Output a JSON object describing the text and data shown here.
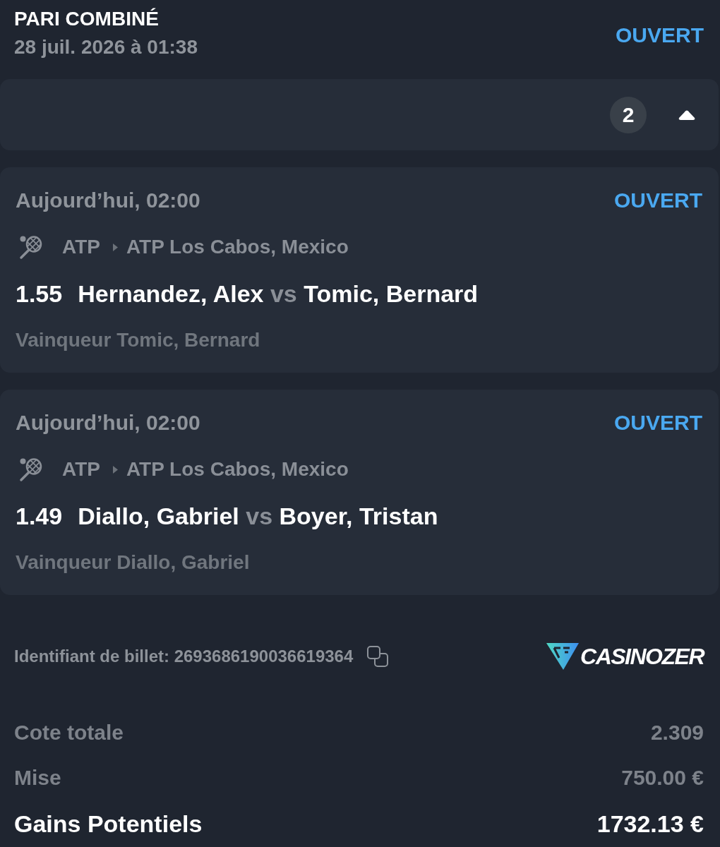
{
  "header": {
    "title": "PARI COMBINÉ",
    "datetime": "28 juil. 2026 à 01:38",
    "status": "OUVERT"
  },
  "selections_panel": {
    "count": "2",
    "expanded": true
  },
  "selections": [
    {
      "time": "Aujourd’hui, 02:00",
      "status": "OUVERT",
      "category": "ATP",
      "tournament": "ATP Los Cabos, Mexico",
      "odds": "1.55",
      "home": "Hernandez, Alex",
      "separator": "vs",
      "away": "Tomic, Bernard",
      "market": "Vainqueur Tomic, Bernard"
    },
    {
      "time": "Aujourd’hui, 02:00",
      "status": "OUVERT",
      "category": "ATP",
      "tournament": "ATP Los Cabos, Mexico",
      "odds": "1.49",
      "home": "Diallo, Gabriel",
      "separator": "vs",
      "away": "Boyer, Tristan",
      "market": "Vainqueur Diallo, Gabriel"
    }
  ],
  "ticket": {
    "id_text": "Identifiant de billet: 2693686190036619364",
    "logo": "CASINOZER"
  },
  "totals": [
    {
      "label": "Cote totale",
      "value": "2.309",
      "kind": "secondary"
    },
    {
      "label": "Mise",
      "value": "750.00 €",
      "kind": "secondary"
    },
    {
      "label": "Gains Potentiels",
      "value": "1732.13 €",
      "kind": "primary"
    }
  ]
}
